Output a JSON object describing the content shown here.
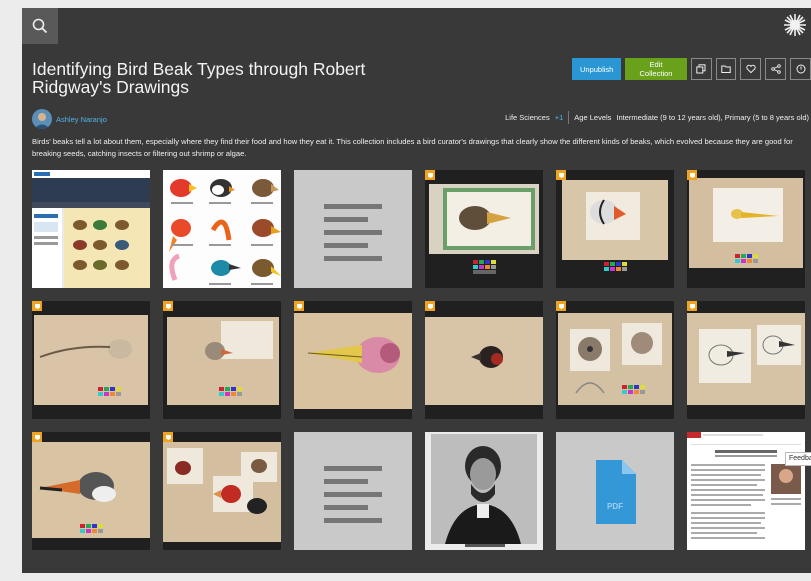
{
  "header": {
    "search_icon": "search-icon",
    "logo_icon": "smithsonian-sun-logo"
  },
  "collection": {
    "title": "Identifying Bird Beak Types through Robert Ridgway's Drawings",
    "author": "Ashley Naranjo",
    "subject": "Life Sciences",
    "subject_more": "+1",
    "age_levels_label": "Age Levels",
    "age_levels_value": "Intermediate (9 to 12 years old), Primary (5 to 8 years old)",
    "description": "Birds' beaks tell a lot about them, especially where they find their food and how they eat it. This collection includes a bird curator's drawings that clearly show the different kinds of beaks, which evolved because they are good for breaking seeds, catching insects or filtering out shrimp or algae."
  },
  "actions": {
    "unpublish_label": "Unpublish",
    "edit_label": "Edit Collection",
    "icons": [
      "copy-icon",
      "folder-icon",
      "heart-icon",
      "share-icon",
      "info-icon"
    ]
  },
  "tiles": [
    {
      "kind": "screenshot",
      "badge": false
    },
    {
      "kind": "beak-chart",
      "badge": false
    },
    {
      "kind": "text-doc",
      "badge": false
    },
    {
      "kind": "drawing",
      "badge": true
    },
    {
      "kind": "drawing",
      "badge": true
    },
    {
      "kind": "drawing",
      "badge": true
    },
    {
      "kind": "drawing",
      "badge": true
    },
    {
      "kind": "drawing",
      "badge": true
    },
    {
      "kind": "drawing",
      "badge": true
    },
    {
      "kind": "drawing",
      "badge": true
    },
    {
      "kind": "drawing",
      "badge": true
    },
    {
      "kind": "drawing",
      "badge": true
    },
    {
      "kind": "drawing",
      "badge": true
    },
    {
      "kind": "drawing",
      "badge": true
    },
    {
      "kind": "text-doc",
      "badge": false
    },
    {
      "kind": "portrait",
      "badge": false
    },
    {
      "kind": "pdf",
      "badge": false,
      "file_label": "PDF"
    },
    {
      "kind": "webpage",
      "badge": false
    }
  ],
  "feedback_label": "Feedback",
  "colors": {
    "background": "#393939",
    "primary_button": "#2a97d4",
    "edit_button": "#6aa11b",
    "badge": "#f0a31e",
    "link": "#4fb3e8"
  }
}
